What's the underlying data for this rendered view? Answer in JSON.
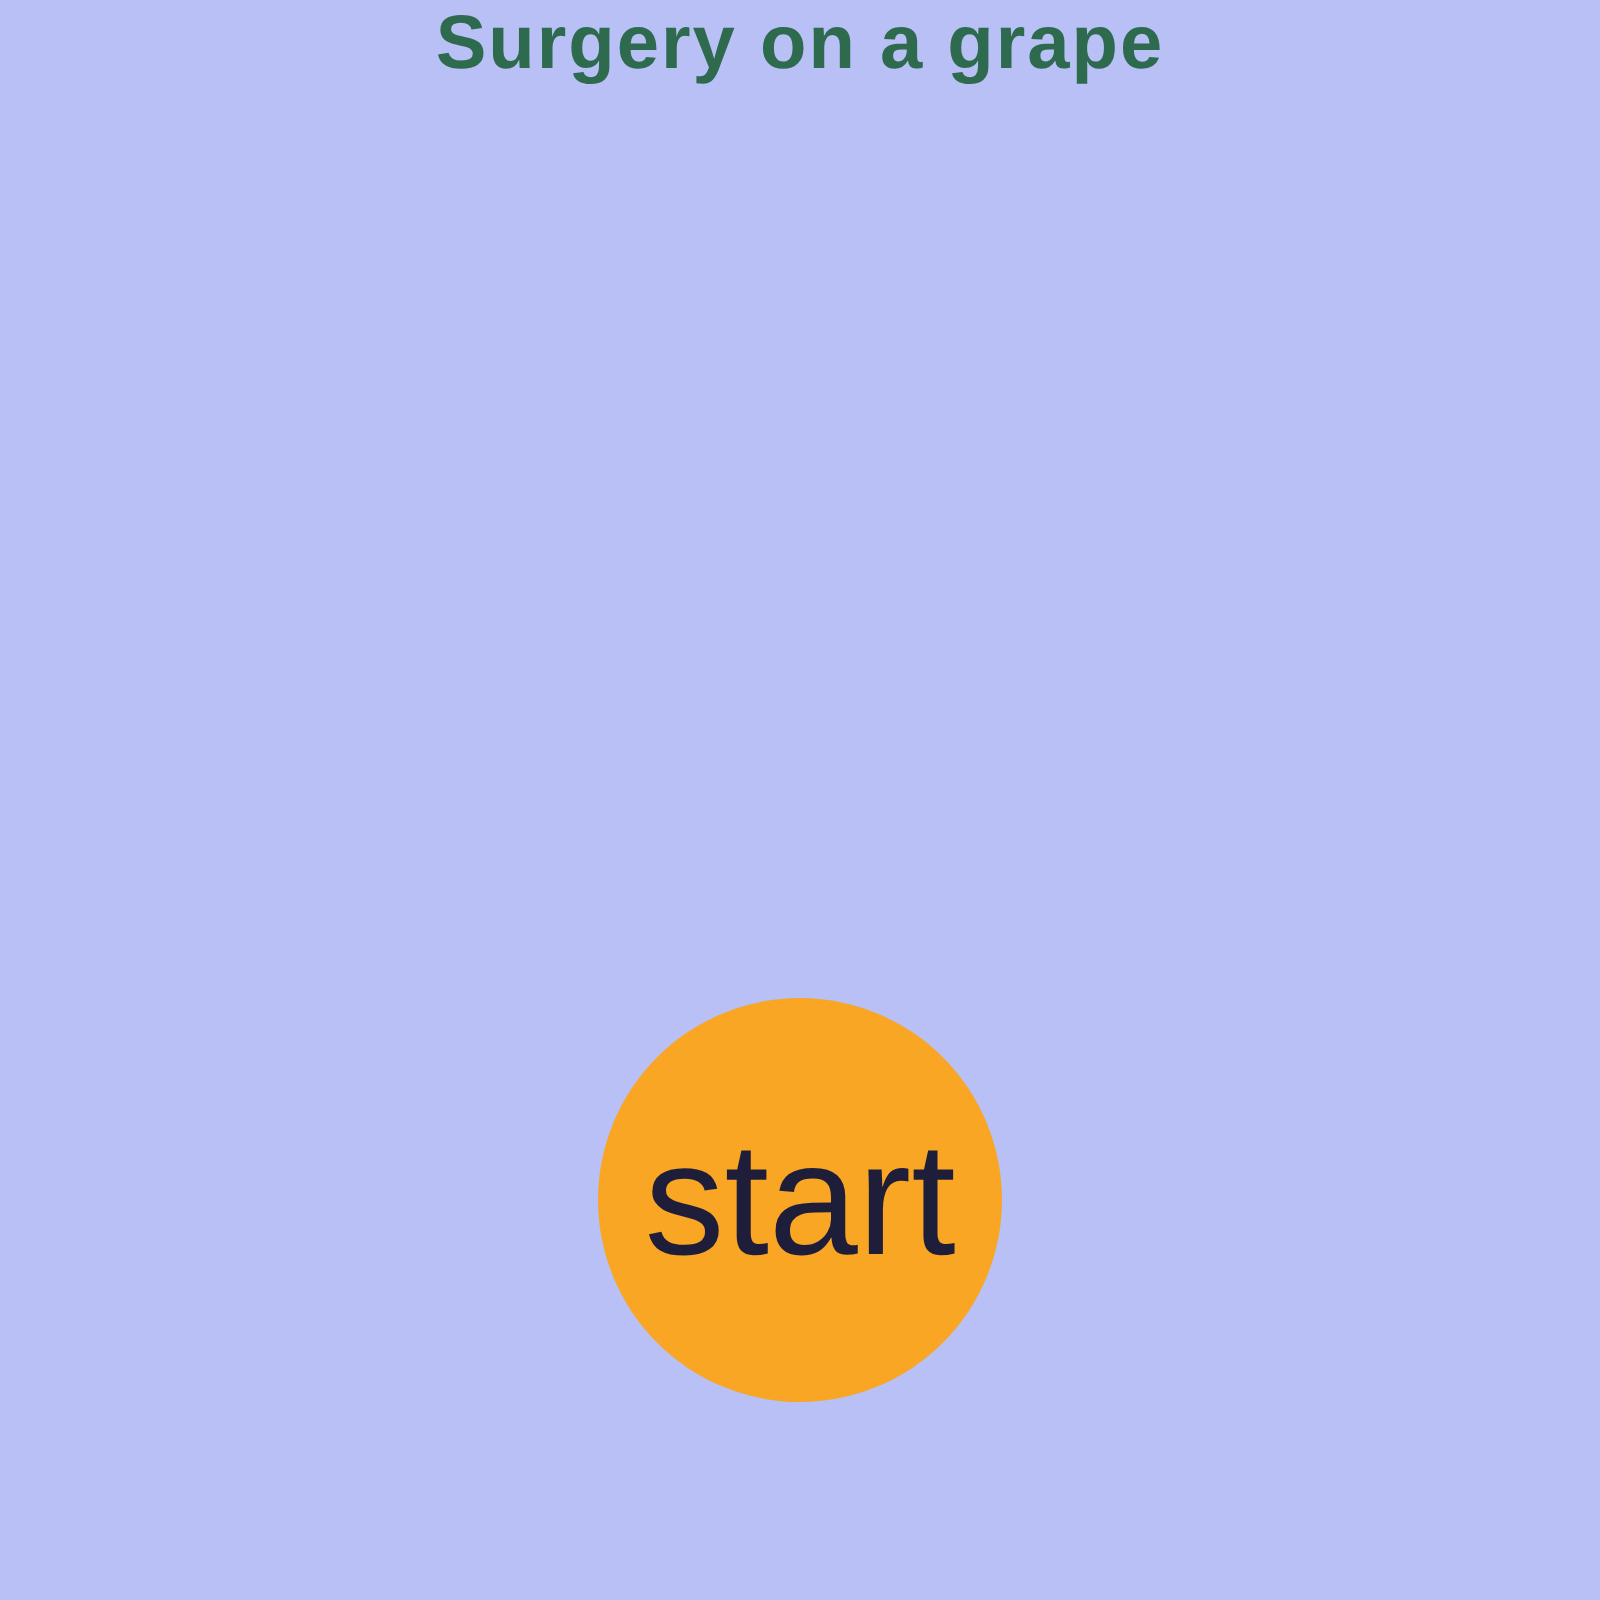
{
  "title": "Surgery on a grape",
  "start_button": {
    "label": "start"
  }
}
